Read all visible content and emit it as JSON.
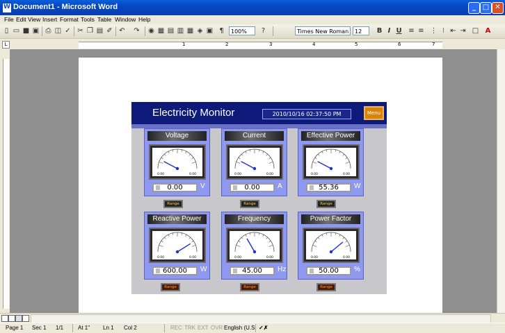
{
  "window": {
    "title": "Document1 - Microsoft Word"
  },
  "menu": [
    "File",
    "Edit",
    "View",
    "Insert",
    "Format",
    "Tools",
    "Table",
    "Window",
    "Help"
  ],
  "toolbar": {
    "zoom": "100%",
    "font": "Times New Roman",
    "size": "12"
  },
  "ruler": {
    "numbers": [
      "1",
      "2",
      "3",
      "4",
      "5",
      "6",
      "7"
    ]
  },
  "status": {
    "page": "Page 1",
    "sec": "Sec 1",
    "pages": "1/1",
    "at": "At 1\"",
    "ln": "Ln 1",
    "col": "Col 2",
    "rec": "REC",
    "trk": "TRK",
    "ext": "EXT",
    "ovr": "OVR",
    "lang": "English (U.S"
  },
  "monitor": {
    "title": "Electricity Monitor",
    "datetime": "2010/10/16 02:37:50 PM",
    "menu_label": "Menu",
    "range_label": "Range",
    "gauges": [
      {
        "title": "Voltage",
        "value": "0.00",
        "unit": "V",
        "min": "0.00",
        "max": "0.00"
      },
      {
        "title": "Current",
        "value": "0.00",
        "unit": "A",
        "min": "0.00",
        "max": "0.00"
      },
      {
        "title": "Effective Power",
        "value": "55.36",
        "unit": "W",
        "min": "0.00",
        "max": "0.00"
      },
      {
        "title": "Reactive Power",
        "value": "600.00",
        "unit": "W",
        "min": "0.00",
        "max": "0.00"
      },
      {
        "title": "Frequency",
        "value": "45.00",
        "unit": "Hz",
        "min": "0.00",
        "max": "0.00"
      },
      {
        "title": "Power Factor",
        "value": "50.00",
        "unit": "%",
        "min": "0.00",
        "max": "0.00"
      }
    ]
  }
}
